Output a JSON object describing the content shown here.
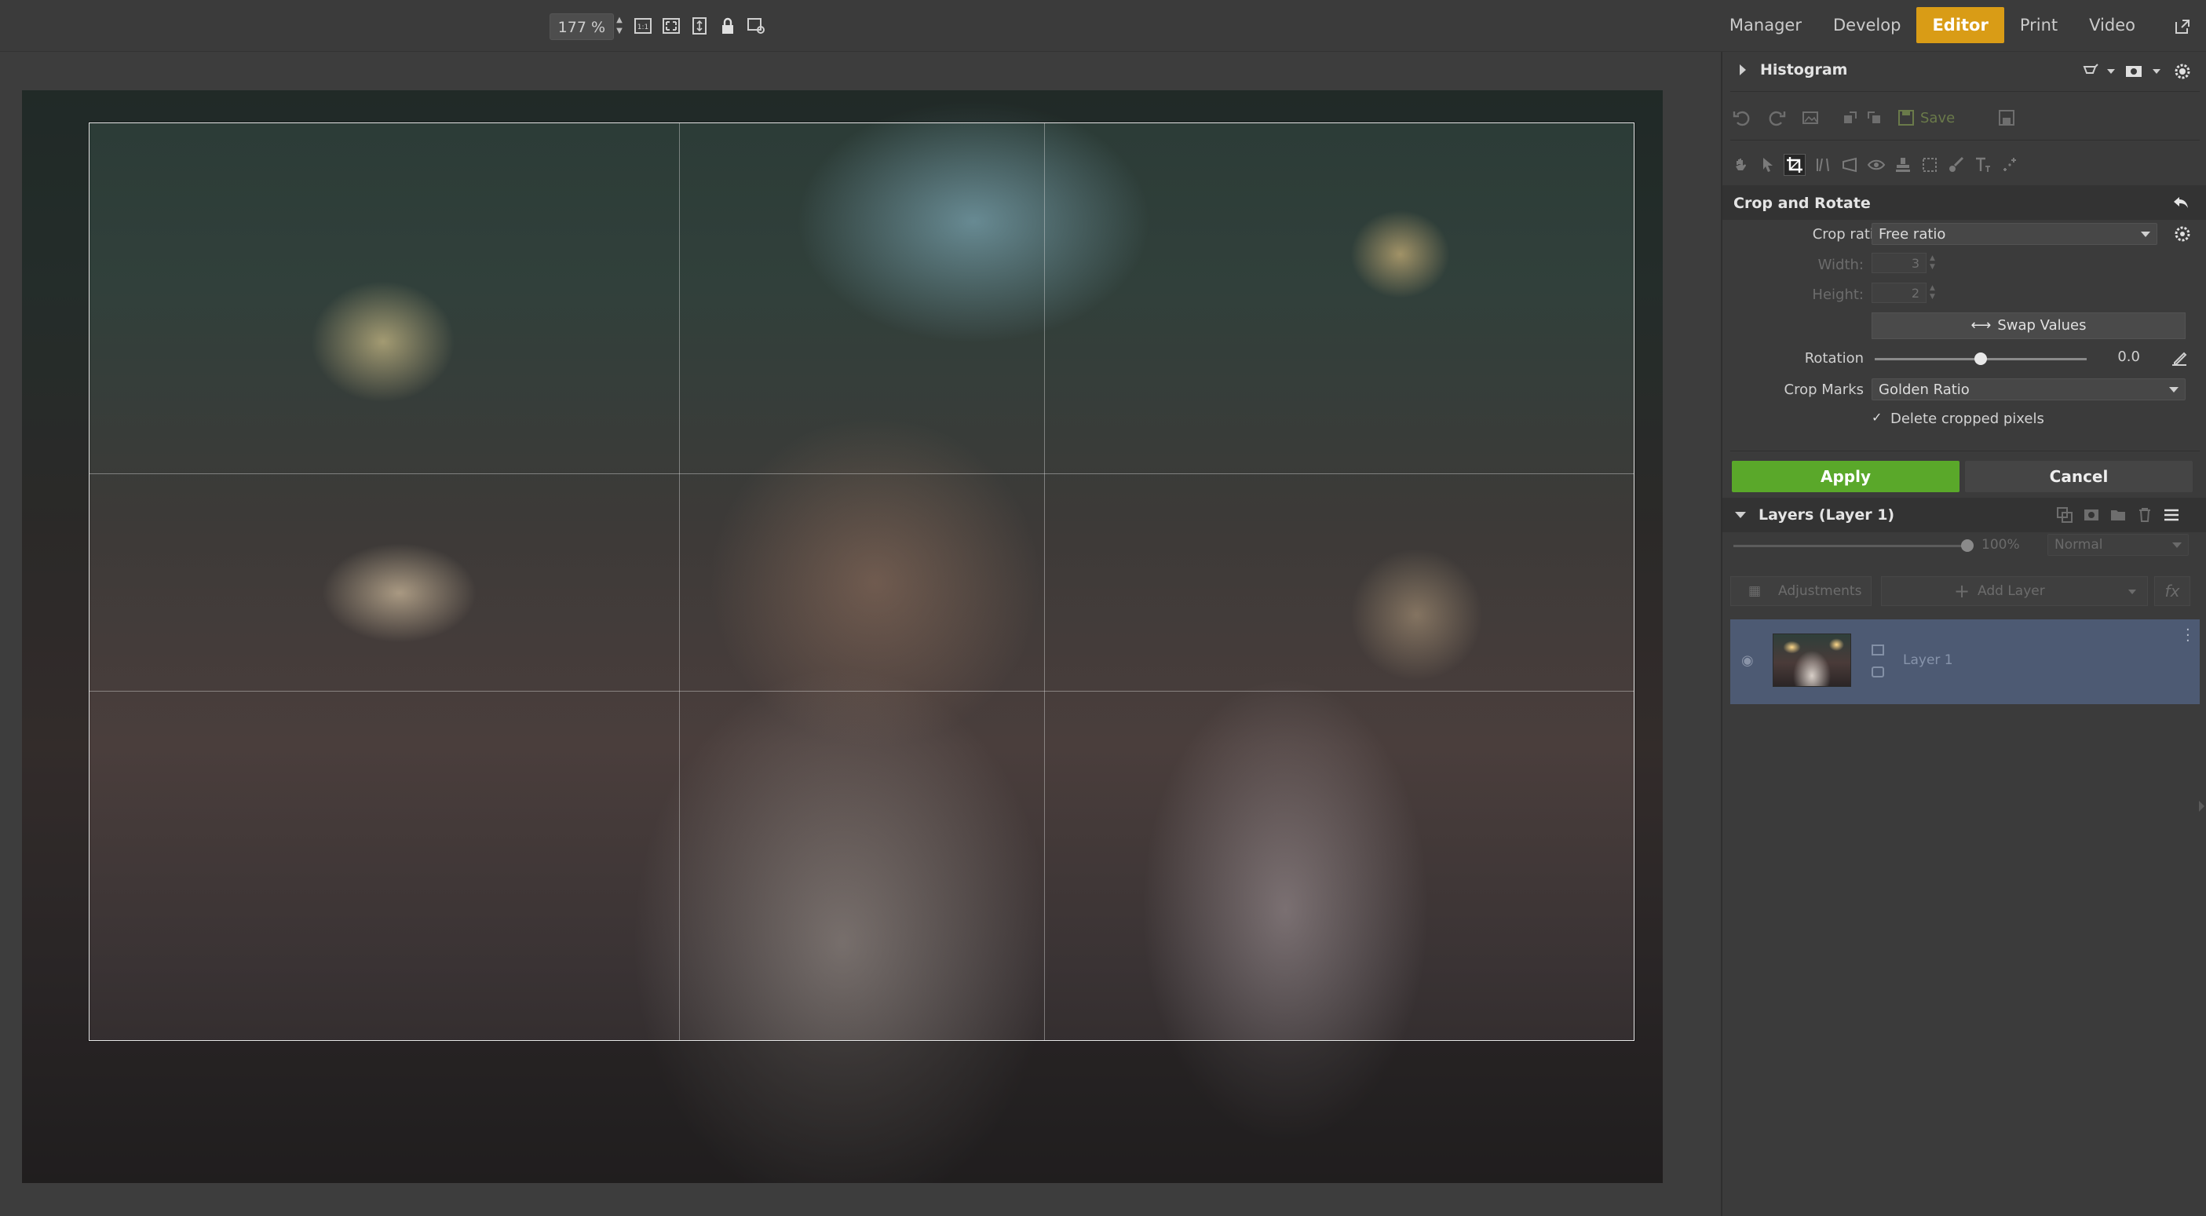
{
  "toolbar": {
    "zoom_value": "177 %",
    "icons": [
      "one-to-one-zoom-icon",
      "fit-to-screen-icon",
      "fit-height-icon",
      "lock-icon",
      "view-settings-icon"
    ]
  },
  "modules": {
    "items": [
      "Manager",
      "Develop",
      "Editor",
      "Print",
      "Video"
    ],
    "active": "Editor"
  },
  "panel": {
    "histogram_title": "Histogram",
    "save_label": "Save",
    "crop": {
      "title": "Crop and Rotate",
      "crop_ratio_label": "Crop ratio:",
      "crop_ratio_value": "Free ratio",
      "width_label": "Width:",
      "width_value": "3",
      "height_label": "Height:",
      "height_value": "2",
      "swap_label": "Swap Values",
      "rotation_label": "Rotation",
      "rotation_value": "0.0",
      "crop_marks_label": "Crop Marks",
      "crop_marks_value": "Golden Ratio",
      "delete_pixels_label": "Delete cropped pixels",
      "delete_pixels_checked": true,
      "apply_label": "Apply",
      "cancel_label": "Cancel"
    },
    "layers": {
      "title": "Layers (Layer 1)",
      "opacity_value": "100%",
      "blend_mode": "Normal",
      "adjustments_label": "Adjustments",
      "add_layer_label": "Add Layer",
      "fx_label": "fx",
      "items": [
        {
          "name": "Layer 1"
        }
      ]
    }
  },
  "colors": {
    "accent_editor": "#d99c16",
    "apply_green": "#5aa82a",
    "layer_selected": "#4d5a73"
  }
}
